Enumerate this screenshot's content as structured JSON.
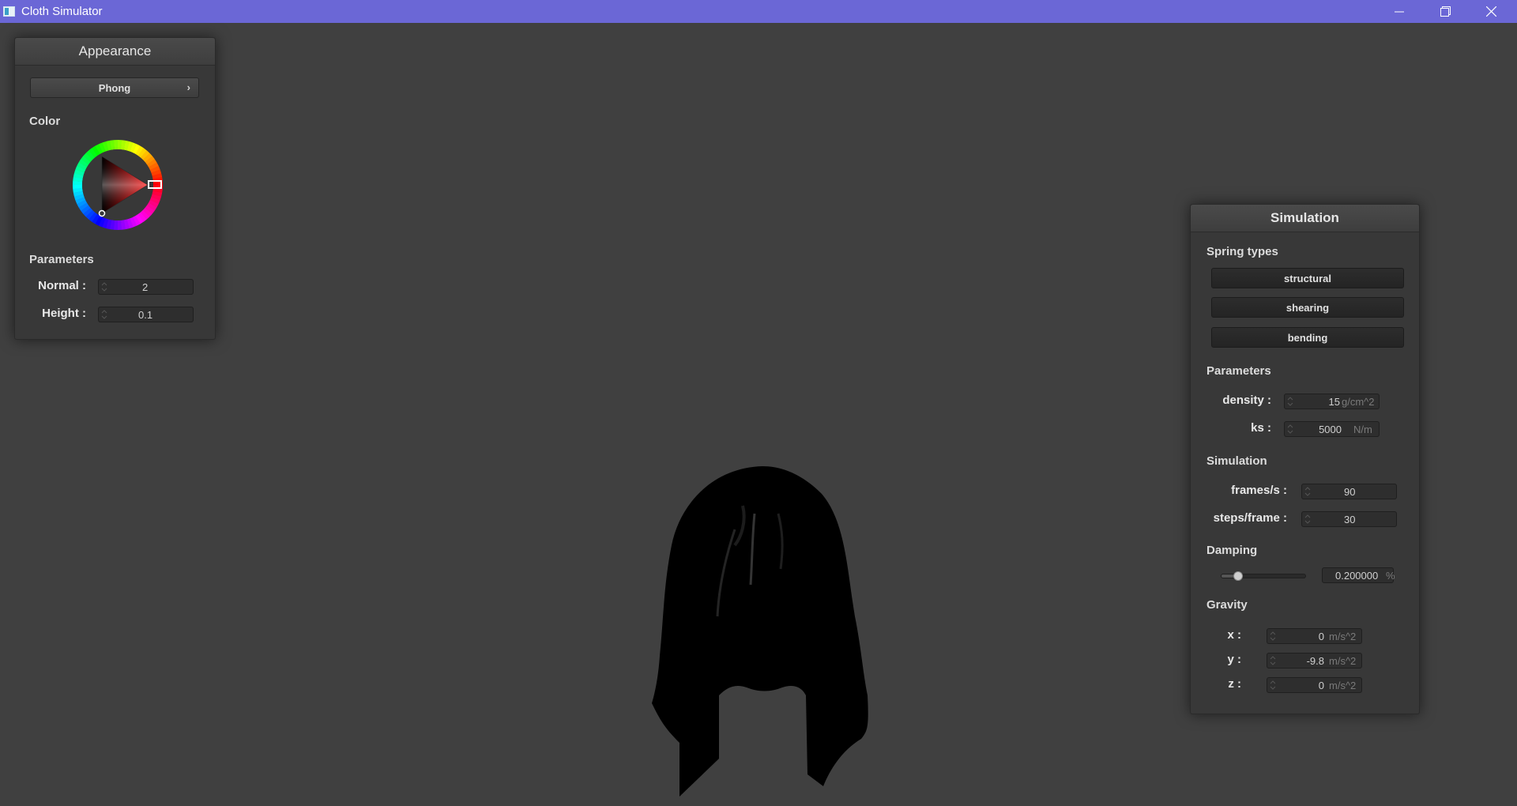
{
  "window": {
    "title": "Cloth Simulator",
    "title_bar_color": "#6b67d6",
    "controls": [
      "minimize-icon",
      "maximize-icon",
      "close-icon"
    ]
  },
  "appearance": {
    "title": "Appearance",
    "shader": "Phong",
    "color_label": "Color",
    "color_value": "#ff0000",
    "parameters_label": "Parameters",
    "normal_label": "Normal :",
    "normal_value": "2",
    "height_label": "Height :",
    "height_value": "0.1"
  },
  "simulation": {
    "title": "Simulation",
    "spring_types_label": "Spring types",
    "spring_types": [
      "structural",
      "shearing",
      "bending"
    ],
    "parameters_label": "Parameters",
    "density_label": "density :",
    "density_value": "15",
    "density_unit": "g/cm^2",
    "ks_label": "ks :",
    "ks_value": "5000",
    "ks_unit": "N/m",
    "simulation_label": "Simulation",
    "fps_label": "frames/s :",
    "fps_value": "90",
    "steps_label": "steps/frame :",
    "steps_value": "30",
    "damping_label": "Damping",
    "damping_value": "0.200000",
    "damping_unit": "%",
    "damping_level": 0.2,
    "gravity_label": "Gravity",
    "gx_label": "x :",
    "gx_value": "0",
    "gy_label": "y :",
    "gy_value": "-9.8",
    "gz_label": "z :",
    "gz_value": "0",
    "gravity_unit": "m/s^2"
  }
}
